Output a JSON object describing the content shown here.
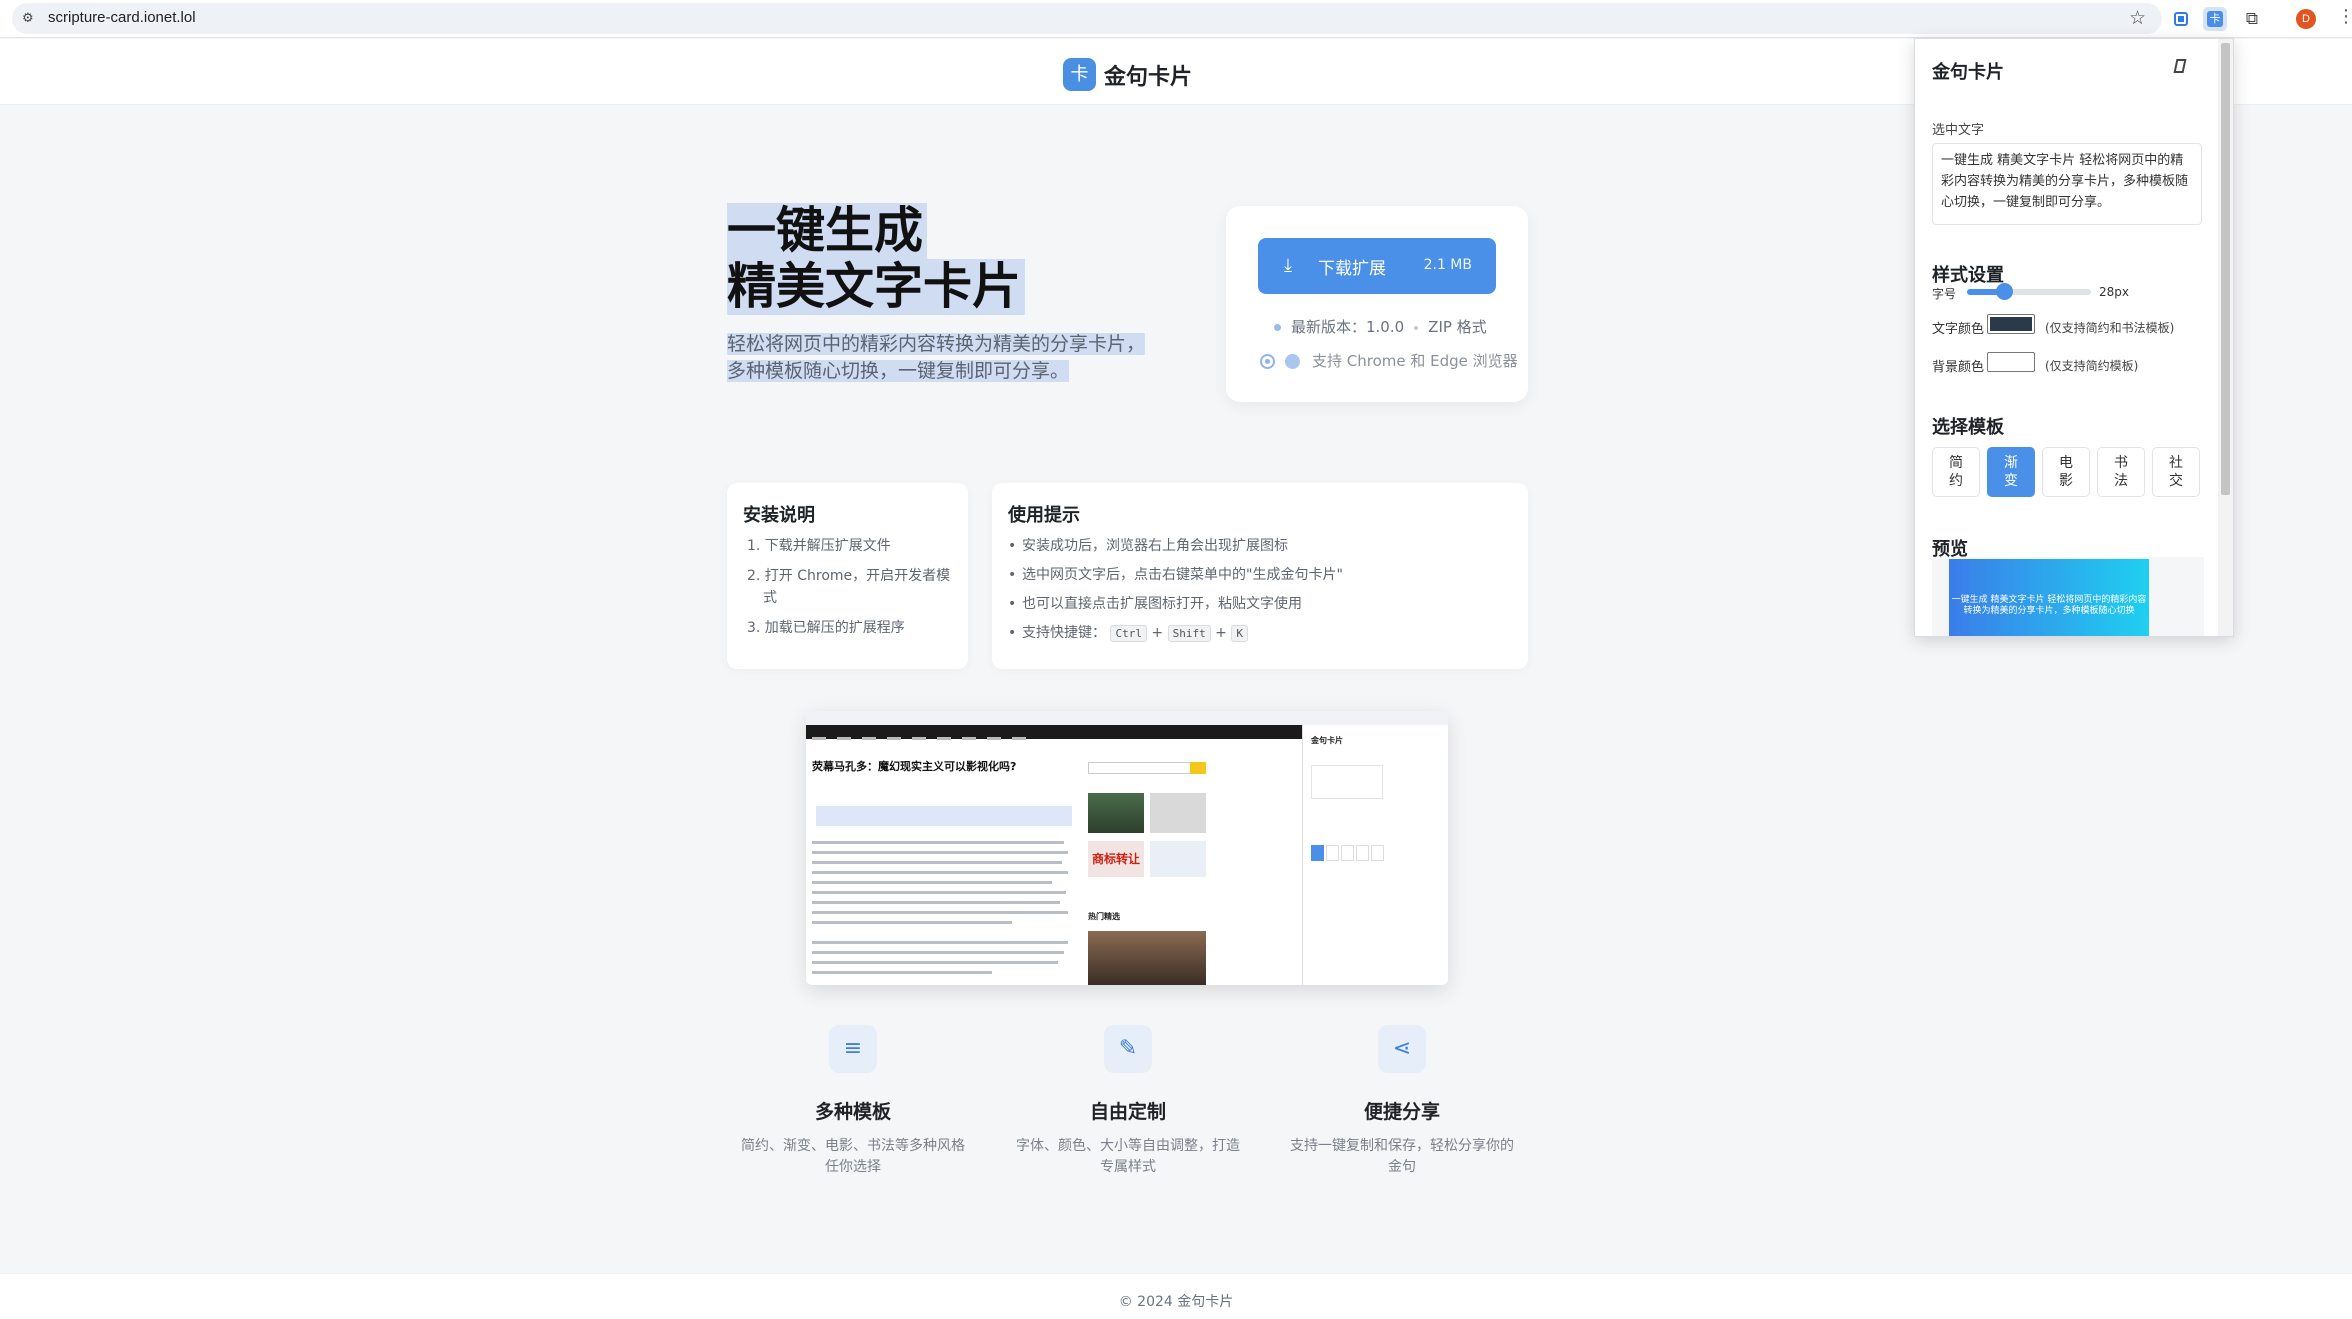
{
  "browser": {
    "url": "scripture-card.ionet.lol",
    "avatar_letter": "D"
  },
  "site": {
    "brand": "金句卡片",
    "logo_glyph": "卡"
  },
  "hero": {
    "title_line1": "一键生成",
    "title_line2": "精美文字卡片",
    "subtitle": "轻松将网页中的精彩内容转换为精美的分享卡片，多种模板随心切换，一键复制即可分享。"
  },
  "download": {
    "button_label": "下载扩展",
    "size": "2.1 MB",
    "version_label": "最新版本：1.0.0",
    "format": "ZIP 格式",
    "browsers": "支持 Chrome 和 Edge 浏览器"
  },
  "install": {
    "title": "安装说明",
    "steps": [
      "1. 下载并解压扩展文件",
      "2. 打开 Chrome，开启开发者模式",
      "3. 加载已解压的扩展程序"
    ]
  },
  "tips": {
    "title": "使用提示",
    "items": [
      "安装成功后，浏览器右上角会出现扩展图标",
      "选中网页文字后，点击右键菜单中的\"生成金句卡片\"",
      "也可以直接点击扩展图标打开，粘贴文字使用",
      "支持快捷键："
    ],
    "keys": [
      "Ctrl",
      "Shift",
      "K"
    ],
    "plus": "+"
  },
  "demo": {
    "headline": "荧幕马孔多：魔幻现实主义可以影视化吗?",
    "hot_label": "热门精选",
    "img_text": "商标转让"
  },
  "features": [
    {
      "icon": "list-icon",
      "glyph": "≡",
      "title": "多种模板",
      "desc": "简约、渐变、电影、书法等多种风格任你选择"
    },
    {
      "icon": "edit-icon",
      "glyph": "✎",
      "title": "自由定制",
      "desc": "字体、颜色、大小等自由调整，打造专属样式"
    },
    {
      "icon": "share-icon",
      "glyph": "⋖",
      "title": "便捷分享",
      "desc": "支持一键复制和保存，轻松分享你的金句"
    }
  ],
  "footer": {
    "text": "© 2024 金句卡片"
  },
  "popup": {
    "title": "金句卡片",
    "selected_label": "选中文字",
    "selected_text": "一键生成 精美文字卡片 轻松将网页中的精彩内容转换为精美的分享卡片，多种模板随心切换，一键复制即可分享。",
    "style_heading": "样式设置",
    "font_size_label": "字号",
    "font_size_value": "28px",
    "font_size_fraction": 0.3,
    "text_color_label": "文字颜色",
    "text_color": "#2b3a4a",
    "text_color_note": "(仅支持简约和书法模板)",
    "bg_color_label": "背景颜色",
    "bg_color": "#ffffff",
    "bg_color_note": "(仅支持简约模板)",
    "template_heading": "选择模板",
    "templates": [
      {
        "l1": "简",
        "l2": "约"
      },
      {
        "l1": "渐",
        "l2": "变"
      },
      {
        "l1": "电",
        "l2": "影"
      },
      {
        "l1": "书",
        "l2": "法"
      },
      {
        "l1": "社",
        "l2": "交"
      }
    ],
    "active_template": 1,
    "preview_heading": "预览",
    "preview_text": "一键生成 精美文字卡片 轻松将网页中的精彩内容转换为精美的分享卡片，多种模板随心切换"
  },
  "colors": {
    "accent": "#4a8fe8",
    "selection": "#cfdcf2"
  }
}
